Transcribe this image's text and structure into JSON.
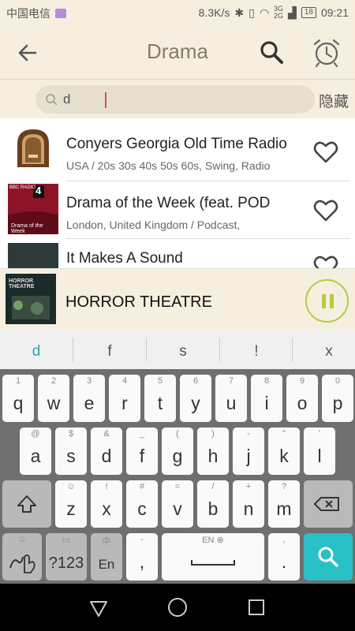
{
  "status_bar": {
    "carrier": "中国电信",
    "speed": "8.3K/s",
    "network_labels": "3G 2G",
    "battery": "18",
    "time": "09:21"
  },
  "app_bar": {
    "title": "Drama",
    "back_icon": "arrow-left-icon",
    "search_icon": "search-icon",
    "alarm_icon": "alarm-clock-icon"
  },
  "search": {
    "value": "d",
    "hide_label": "隐藏"
  },
  "stations": [
    {
      "title": "Conyers Georgia Old Time Radio",
      "subtitle": "USA / 20s 30s 40s 50s 60s, Swing, Radio"
    },
    {
      "title": "Drama of the Week (feat. POD",
      "subtitle": "London, United Kingdom / Podcast,",
      "thumb_badge": "4",
      "thumb_caption": "Drama of the Week",
      "thumb_logo": "BBC RADIO"
    },
    {
      "title": "It Makes A Sound",
      "subtitle": ""
    }
  ],
  "player": {
    "now_playing": "HORROR THEATRE",
    "art_text": "HORROR THEATRE"
  },
  "keyboard": {
    "suggestions": [
      "d",
      "f",
      "s",
      "!",
      "x"
    ],
    "row1": [
      {
        "main": "q",
        "alt": "1"
      },
      {
        "main": "w",
        "alt": "2"
      },
      {
        "main": "e",
        "alt": "3"
      },
      {
        "main": "r",
        "alt": "4"
      },
      {
        "main": "t",
        "alt": "5"
      },
      {
        "main": "y",
        "alt": "6"
      },
      {
        "main": "u",
        "alt": "7"
      },
      {
        "main": "i",
        "alt": "8"
      },
      {
        "main": "o",
        "alt": "9"
      },
      {
        "main": "p",
        "alt": "0"
      }
    ],
    "row2": [
      {
        "main": "a",
        "alt": "@"
      },
      {
        "main": "s",
        "alt": "$"
      },
      {
        "main": "d",
        "alt": "&"
      },
      {
        "main": "f",
        "alt": "_"
      },
      {
        "main": "g",
        "alt": "("
      },
      {
        "main": "h",
        "alt": ")"
      },
      {
        "main": "j",
        "alt": "-"
      },
      {
        "main": "k",
        "alt": "\""
      },
      {
        "main": "l",
        "alt": "'"
      }
    ],
    "row3": [
      {
        "main": "z",
        "alt": "☺"
      },
      {
        "main": "x",
        "alt": "!"
      },
      {
        "main": "c",
        "alt": "#"
      },
      {
        "main": "v",
        "alt": "="
      },
      {
        "main": "b",
        "alt": "/"
      },
      {
        "main": "n",
        "alt": "+"
      },
      {
        "main": "m",
        "alt": "?"
      }
    ],
    "symbols_label": "?123",
    "lang_label": "En",
    "lang_alt": "中",
    "comma": ",",
    "comma_alt": "-",
    "space_label": "EN ⊕",
    "period": ".",
    "period_alt": ","
  },
  "colors": {
    "background": "#f6efe0",
    "accent_green": "#b5cc3e",
    "enter_key": "#29c0c6",
    "caret": "#e0457a"
  }
}
